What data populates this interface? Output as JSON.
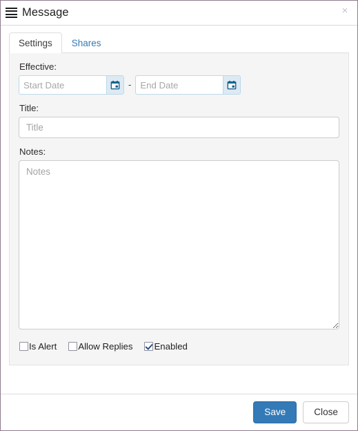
{
  "window": {
    "title": "Message",
    "menu_icon": "hamburger-icon",
    "close_icon": "×"
  },
  "tabs": [
    {
      "label": "Settings",
      "active": true
    },
    {
      "label": "Shares",
      "active": false
    }
  ],
  "form": {
    "effective": {
      "label": "Effective:",
      "separator": "-",
      "start": {
        "value": "",
        "placeholder": "Start Date",
        "picker_icon": "calendar-icon"
      },
      "end": {
        "value": "",
        "placeholder": "End Date",
        "picker_icon": "calendar-icon"
      }
    },
    "title": {
      "label": "Title:",
      "value": "",
      "placeholder": "Title"
    },
    "notes": {
      "label": "Notes:",
      "value": "",
      "placeholder": "Notes"
    },
    "checkboxes": [
      {
        "label": "Is Alert",
        "checked": false
      },
      {
        "label": "Allow Replies",
        "checked": false
      },
      {
        "label": "Enabled",
        "checked": true
      }
    ]
  },
  "footer": {
    "save_label": "Save",
    "close_label": "Close"
  },
  "colors": {
    "primary": "#337ab7",
    "primary_border": "#2e6da4",
    "dialog_border": "#8b7b8b",
    "panel_bg": "#f5f5f5",
    "link": "#337ab7",
    "date_border": "#bcd9ea",
    "date_btn_bg": "#ddeaf3"
  }
}
